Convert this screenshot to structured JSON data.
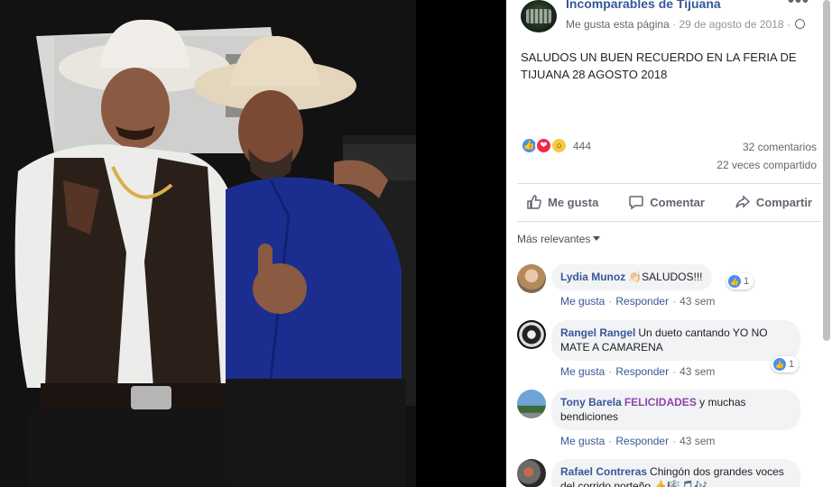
{
  "post": {
    "page_name": "Incomparables de Tijuana",
    "like_page": "Me gusta esta página",
    "date": "29 de agosto de 2018",
    "meta_sep": "·",
    "text": "SALUDOS UN BUEN RECUERDO EN LA FERIA DE TIJUANA 28 AGOSTO 2018",
    "more": "•••",
    "reaction_count": "444",
    "comments_count": "32 comentarios",
    "shares_count": "22 veces compartido"
  },
  "actions": {
    "like": "Me gusta",
    "comment": "Comentar",
    "share": "Compartir"
  },
  "sort_label": "Más relevantes",
  "comment_actions": {
    "like": "Me gusta",
    "reply": "Responder",
    "sep": "·"
  },
  "comments": [
    {
      "name": "Lydia Munoz",
      "pre": "",
      "mention": "",
      "text": "👏🏻SALUDOS!!!",
      "time": "43 sem",
      "likes": "1"
    },
    {
      "name": "Rangel Rangel",
      "pre": "",
      "mention": "",
      "text": "Un dueto cantando YO NO MATE A CAMARENA",
      "time": "43 sem",
      "likes": "1"
    },
    {
      "name": "Tony Barela",
      "pre": "",
      "mention": "FELICIDADES",
      "text": " y muchas bendiciones",
      "time": "43 sem",
      "likes": ""
    },
    {
      "name": "Rafael Contreras",
      "pre": "",
      "mention": "",
      "text": "Chingón dos grandes voces del corrido norteño 👍🎼🎵🎶",
      "time": "",
      "likes": ""
    }
  ],
  "colors": {
    "link": "#385898",
    "like_blue": "#4a8ef0",
    "love_red": "#f0284a",
    "wow_yellow": "#f7c940"
  }
}
